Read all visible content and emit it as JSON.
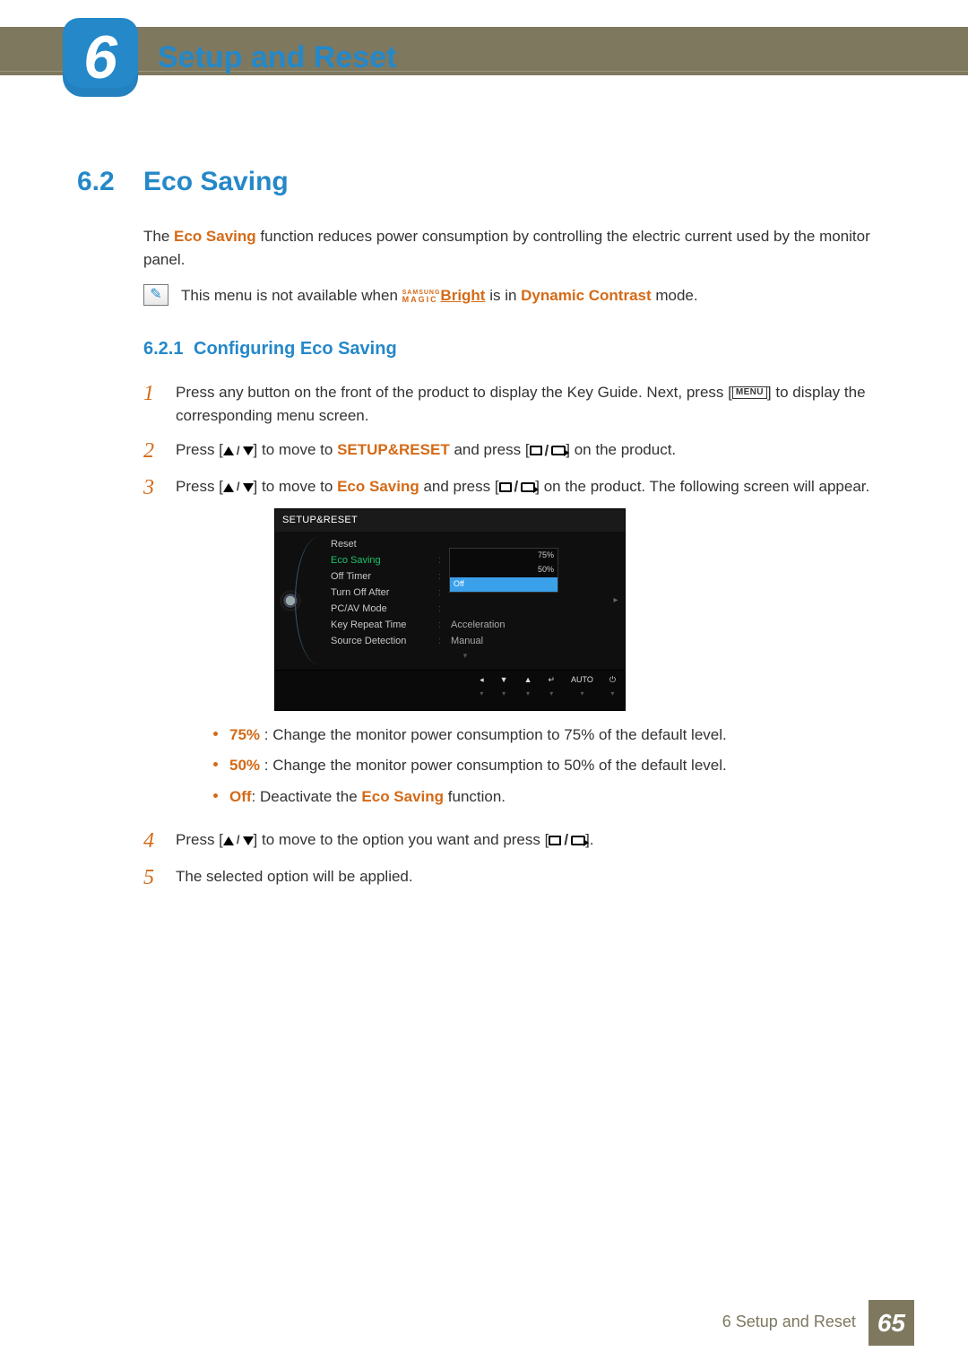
{
  "chapter": {
    "number": "6",
    "title": "Setup and Reset"
  },
  "section": {
    "number": "6.2",
    "title": "Eco Saving"
  },
  "intro": {
    "pre": "The ",
    "feature": "Eco Saving",
    "post": " function reduces power consumption by controlling the electric current used by the monitor panel."
  },
  "note": {
    "pre": "This menu is not available when ",
    "magic_top": "SAMSUNG",
    "magic_bot": "MAGIC",
    "magic_right": "Bright",
    "mid": " is in ",
    "mode": "Dynamic Contrast",
    "post": " mode."
  },
  "subsection": {
    "number": "6.2.1",
    "title": "Configuring Eco Saving"
  },
  "steps": {
    "s1": {
      "pre": "Press any button on the front of the product to display the Key Guide. Next, press [",
      "menu": "MENU",
      "post": "] to display the corresponding menu screen."
    },
    "s2": {
      "pre": "Press [",
      "mid1": "] to move to ",
      "target": "SETUP&RESET",
      "mid2": " and press [",
      "post": "] on the product."
    },
    "s3": {
      "pre": "Press [",
      "mid1": "] to move to ",
      "target": "Eco Saving",
      "mid2": " and press [",
      "post": "] on the product. The following screen will appear."
    },
    "s4": {
      "pre": "Press [",
      "mid1": "] to move to the option you want and press [",
      "post": "]."
    },
    "s5": "The selected option will be applied."
  },
  "step_numbers": {
    "n1": "1",
    "n2": "2",
    "n3": "3",
    "n4": "4",
    "n5": "5"
  },
  "osd": {
    "title": "SETUP&RESET",
    "items": {
      "reset": "Reset",
      "eco": "Eco Saving",
      "offtimer": "Off Timer",
      "turnoff": "Turn Off After",
      "pcav": "PC/AV Mode",
      "keyrep": "Key Repeat Time",
      "srcdet": "Source Detection"
    },
    "values": {
      "keyrep": "Acceleration",
      "srcdet": "Manual"
    },
    "select": {
      "opt75": "75%",
      "opt50": "50%",
      "optOff": "Off"
    },
    "buttons": {
      "auto": "AUTO"
    }
  },
  "options": {
    "o1": {
      "label": "75%",
      "sep": " : ",
      "text": "Change the monitor power consumption to 75% of the default level."
    },
    "o2": {
      "label": "50%",
      "sep": " : ",
      "text": "Change the monitor power consumption to 50% of the default level."
    },
    "o3": {
      "label": "Off",
      "sep": ": ",
      "mid": "Deactivate the ",
      "feature": "Eco Saving",
      "post": " function."
    }
  },
  "footer": {
    "text": "6 Setup and Reset",
    "page": "65"
  }
}
